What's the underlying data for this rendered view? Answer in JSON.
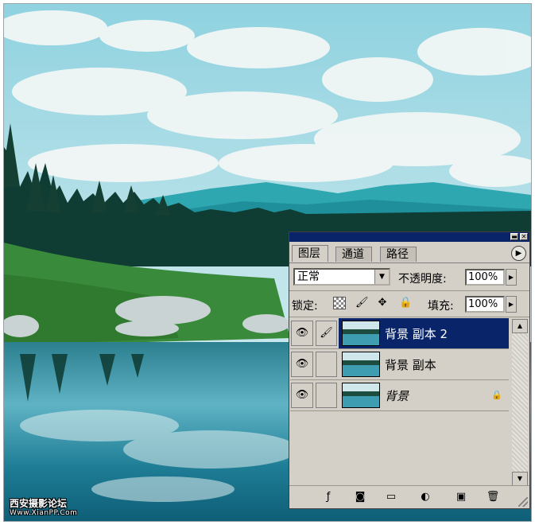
{
  "watermark": {
    "line1": "西安摄影论坛",
    "line2": "Www.XianPP.Com"
  },
  "palette": {
    "tabs": [
      {
        "label": "图层",
        "active": true
      },
      {
        "label": "通道",
        "active": false
      },
      {
        "label": "路径",
        "active": false
      }
    ],
    "blend_mode": "正常",
    "opacity_label": "不透明度:",
    "opacity_value": "100%",
    "lock_label": "锁定:",
    "fill_label": "填充:",
    "fill_value": "100%",
    "layers": [
      {
        "name": "背景 副本 2",
        "selected": true,
        "visible": true,
        "brush": true
      },
      {
        "name": "背景 副本",
        "selected": false,
        "visible": true,
        "brush": false
      },
      {
        "name": "背景",
        "selected": false,
        "visible": true,
        "brush": false,
        "locked": true
      }
    ],
    "icons": {
      "menu": "palette-menu-icon",
      "eye": "eye-icon",
      "brush": "brush-icon",
      "lock": "lock-icon"
    }
  }
}
